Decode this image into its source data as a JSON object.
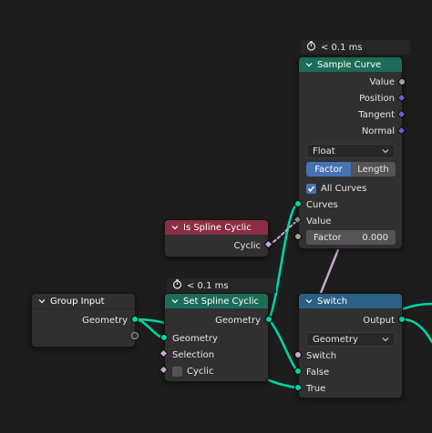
{
  "colors": {
    "background": "#1d1d1d",
    "node_body": "#303030",
    "geometry_header": "#1b6c58",
    "function_header": "#8a2f43",
    "converter_header": "#2c5f84",
    "geometry_socket": "#00d4a3",
    "float_socket": "#a1a1a1",
    "vector_socket": "#6363c7",
    "boolean_socket": "#cca6d6",
    "accent": "#4772b3"
  },
  "sample_curve": {
    "timer": "< 0.1 ms",
    "title": "Sample Curve",
    "outputs": [
      "Value",
      "Position",
      "Tangent",
      "Normal"
    ],
    "data_type": "Float",
    "mode_options": [
      "Factor",
      "Length"
    ],
    "mode_selected": "Factor",
    "all_curves_label": "All Curves",
    "all_curves_checked": true,
    "input_curves": "Curves",
    "input_value": "Value",
    "factor_label": "Factor",
    "factor_value": "0.000"
  },
  "is_spline_cyclic": {
    "title": "Is Spline Cyclic",
    "output": "Cyclic"
  },
  "group_input": {
    "title": "Group Input",
    "output": "Geometry"
  },
  "set_spline_cyclic": {
    "timer": "< 0.1 ms",
    "title": "Set Spline Cyclic",
    "output": "Geometry",
    "inputs": [
      "Geometry",
      "Selection",
      "Cyclic"
    ],
    "cyclic_checked": false
  },
  "switch": {
    "title": "Switch",
    "output": "Output",
    "input_type": "Geometry",
    "inputs": [
      "Switch",
      "False",
      "True"
    ]
  }
}
